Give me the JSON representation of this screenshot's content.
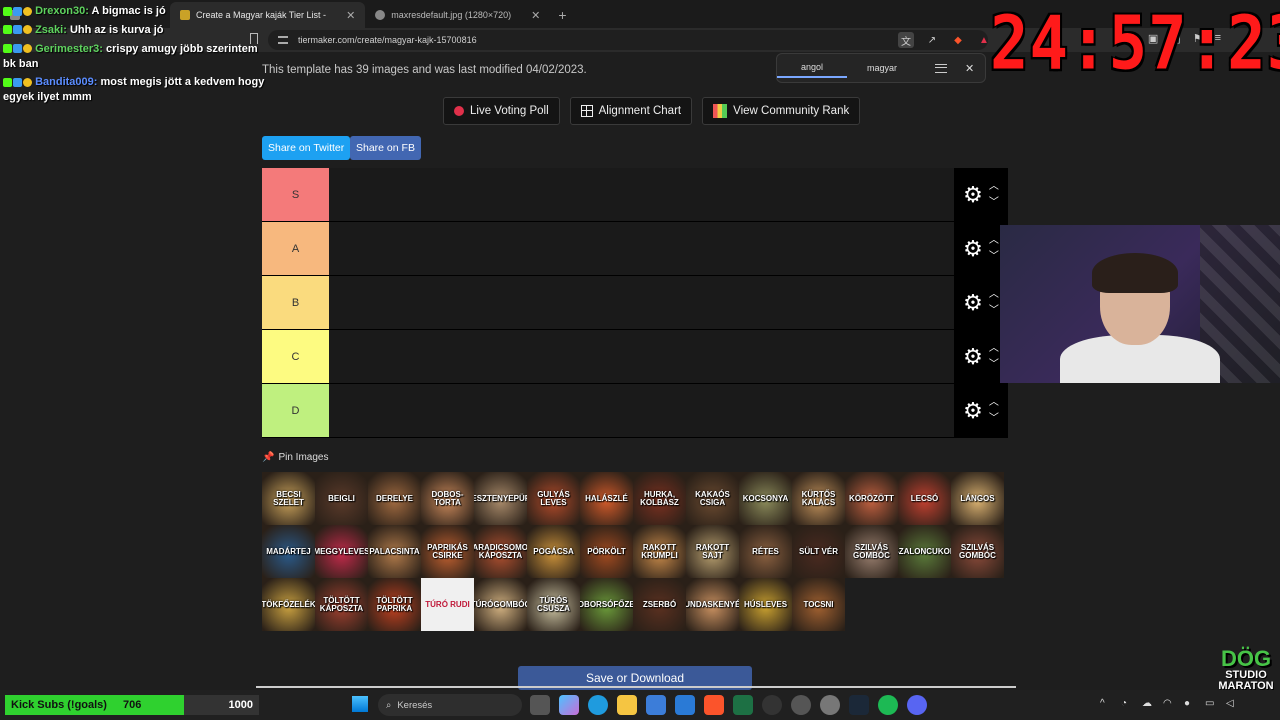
{
  "browser": {
    "tabs": [
      {
        "label": "",
        "active": false
      },
      {
        "label": "Create a Magyar kaják Tier List -",
        "active": true
      },
      {
        "label": "maxresdefault.jpg (1280×720)",
        "active": false
      }
    ],
    "url": "tiermaker.com/create/magyar-kajk-15700816"
  },
  "translate": {
    "lang_from": "angol",
    "lang_to": "magyar"
  },
  "page": {
    "info": "This template has 39 images and was last modified 04/02/2023.",
    "buttons": {
      "live": "Live Voting Poll",
      "align": "Alignment Chart",
      "rank": "View Community Rank"
    },
    "share_twitter": "Share on Twitter",
    "share_fb": "Share on FB",
    "tiers": [
      {
        "label": "S",
        "color": "#f47a7a"
      },
      {
        "label": "A",
        "color": "#f7b87e"
      },
      {
        "label": "B",
        "color": "#fadb7e"
      },
      {
        "label": "C",
        "color": "#fdfb81"
      },
      {
        "label": "D",
        "color": "#bff07f"
      }
    ],
    "pin_label": "Pin Images",
    "images": [
      {
        "text": "BECSI SZELET",
        "color": "#c8a15a"
      },
      {
        "text": "BEIGLI",
        "color": "#5a3a2a"
      },
      {
        "text": "DERELYE",
        "color": "#a06a40"
      },
      {
        "text": "DOBOS-TORTA",
        "color": "#c9885a"
      },
      {
        "text": "GESZTENYEPÜRÉ",
        "color": "#a88a6a"
      },
      {
        "text": "GULYÁS LEVES",
        "color": "#b04a2a"
      },
      {
        "text": "HALÁSZLÉ",
        "color": "#d05a2a"
      },
      {
        "text": "HURKA, KOLBÁSZ",
        "color": "#7a3020"
      },
      {
        "text": "KAKAÓS CSIGA",
        "color": "#6a4a30"
      },
      {
        "text": "KOCSONYA",
        "color": "#8a8a5a"
      },
      {
        "text": "KÜRTŐS KALÁCS",
        "color": "#c0905a"
      },
      {
        "text": "KÖRÖZÖTT",
        "color": "#c06040"
      },
      {
        "text": "LECSÓ",
        "color": "#c04030"
      },
      {
        "text": "LÁNGOS",
        "color": "#d8b070"
      },
      {
        "text": "MADÁRTEJ",
        "color": "#2a5a8a"
      },
      {
        "text": "MEGGYLEVES",
        "color": "#c02a4a"
      },
      {
        "text": "PALACSINTA",
        "color": "#b07a4a"
      },
      {
        "text": "PAPRIKÁS CSIRKE",
        "color": "#c06030"
      },
      {
        "text": "PARADICSOMOS KÁPOSZTA",
        "color": "#b05030"
      },
      {
        "text": "POGÁCSA",
        "color": "#c8903a"
      },
      {
        "text": "PÖRKÖLT",
        "color": "#a04a20"
      },
      {
        "text": "RAKOTT KRUMPLI",
        "color": "#c88a4a"
      },
      {
        "text": "RAKOTT SAJT",
        "color": "#b8a070"
      },
      {
        "text": "RÉTES",
        "color": "#8a6040"
      },
      {
        "text": "SÜLT VÉR",
        "color": "#4a2a20"
      },
      {
        "text": "SZILVÁS GOMBÓC",
        "color": "#9a8070"
      },
      {
        "text": "SZALONCUKOR",
        "color": "#5a7a3a"
      },
      {
        "text": "SZILVÁS GOMBÓC",
        "color": "#8a4a3a"
      },
      {
        "text": "TÖKFŐZELÉK",
        "color": "#c8a040"
      },
      {
        "text": "TÖLTÖTT KÁPOSZTA",
        "color": "#a04030"
      },
      {
        "text": "TÖLTÖTT PAPRIKA",
        "color": "#c04020"
      },
      {
        "text": "TÚRÓ RUDI",
        "color": "#f0f0f0"
      },
      {
        "text": "TÚRÓGOMBÓC",
        "color": "#d0b080"
      },
      {
        "text": "TÚRÓS CSUSZA",
        "color": "#c8c0a0"
      },
      {
        "text": "ZÖLDBORSÓFŐZELÉK",
        "color": "#6a9a3a"
      },
      {
        "text": "ZSERBÓ",
        "color": "#5a3020"
      },
      {
        "text": "PUNDASKENYÉR",
        "color": "#c89060"
      },
      {
        "text": "HÚSLEVES",
        "color": "#c8a030"
      },
      {
        "text": "TOCSNI",
        "color": "#a06030"
      }
    ],
    "save_label": "Save or Download"
  },
  "chat": [
    {
      "user": "Drexon30",
      "text": "A bigmac is jó"
    },
    {
      "user": "Zsaki",
      "text": "Uhh az is kurva jó"
    },
    {
      "user": "Gerimester3",
      "text": "crispy amugy jöbb szerintem bk ban"
    },
    {
      "user": "Bandita009",
      "text": "most megis jött a kedvem hogy egyek ilyet mmm"
    }
  ],
  "timer": "24:57:23",
  "logo": {
    "line1": "DÖG",
    "line2": "STUDIO",
    "line3": "MARATON"
  },
  "subs": {
    "label": "Kick Subs (!goals)",
    "current": "706",
    "goal": "1000",
    "fill_fraction": 0.706
  },
  "taskbar": {
    "search_placeholder": "Keresés"
  }
}
